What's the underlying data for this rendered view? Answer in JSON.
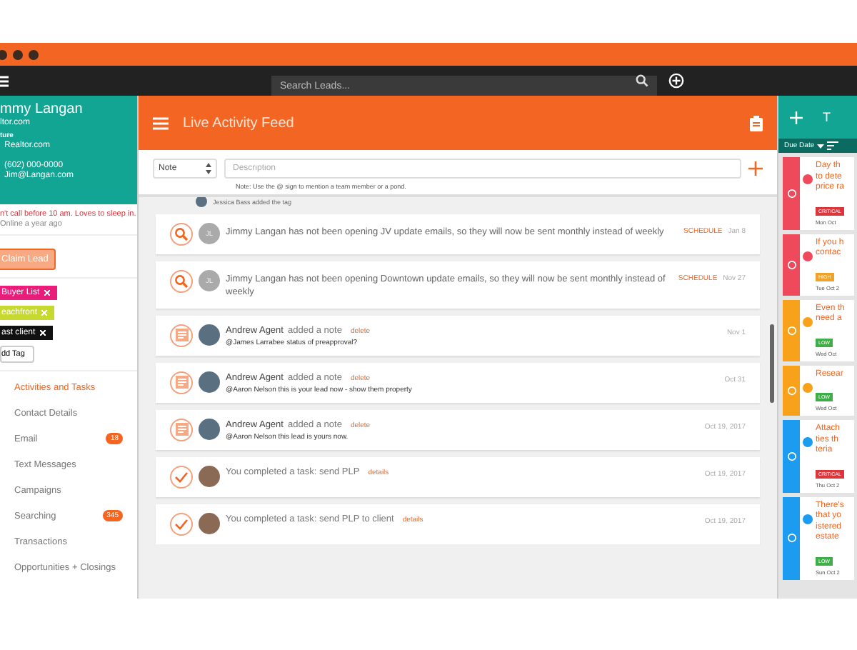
{
  "topbar": {
    "search": {
      "placeholder": "Search Leads..."
    }
  },
  "contact": {
    "name": "mmy Langan",
    "email_short": "ltor.com",
    "label": "ture",
    "source": "Realtor.com",
    "phone": "(602) 000-0000",
    "email": "Jim@Langan.com",
    "note": "n't call before 10 am. Loves to sleep in.",
    "last_seen": "Online a year ago",
    "claim_button": "Claim Lead",
    "tags": [
      {
        "label": "Buyer List",
        "color": "#e91e7a"
      },
      {
        "label": "eachfront",
        "color": "#c6d92e"
      },
      {
        "label": "ast client",
        "color": "#111111"
      }
    ],
    "add_tag": "dd Tag"
  },
  "nav": [
    {
      "label": "Activities and Tasks",
      "selected": true
    },
    {
      "label": "Contact Details",
      "selected": false
    },
    {
      "label": "Email",
      "selected": false,
      "badge": "18"
    },
    {
      "label": "Text Messages",
      "selected": false
    },
    {
      "label": "Campaigns",
      "selected": false
    },
    {
      "label": "Searching",
      "selected": false,
      "badge": "345"
    },
    {
      "label": "Transactions",
      "selected": false
    },
    {
      "label": "Opportunities + Closings",
      "selected": false
    }
  ],
  "feed": {
    "title": "Live Activity Feed",
    "type_select": "Note",
    "description": {
      "placeholder": "Description"
    },
    "hint": "Note: Use the @ sign to mention a team member or a pond.",
    "partial_row": "Jessica Bass added the tag",
    "items": [
      {
        "kind": "search",
        "initials": "JL",
        "text": "Jimmy Langan has not been opening JV update emails, so they will now be sent monthly instead of weekly",
        "action": "SCHEDULE",
        "date": "Jan 8"
      },
      {
        "kind": "search",
        "initials": "JL",
        "text": "Jimmy Langan has not been opening Downtown update emails, so they will now be sent monthly instead of weekly",
        "action": "SCHEDULE",
        "date": "Nov 27"
      },
      {
        "kind": "note",
        "author": "Andrew Agent",
        "verb": "added a note",
        "action": "delete",
        "body": "@James Larrabee status of preapproval?",
        "date": "Nov 1"
      },
      {
        "kind": "note",
        "author": "Andrew Agent",
        "verb": "added a note",
        "action": "delete",
        "body": "@Aaron Nelson this is your lead now - show them property",
        "date": "Oct 31"
      },
      {
        "kind": "note",
        "author": "Andrew Agent",
        "verb": "added a note",
        "action": "delete",
        "body": "@Aaron Nelson this lead is yours now.",
        "date": "Oct 19, 2017"
      },
      {
        "kind": "task",
        "text": "You completed a task: send PLP",
        "action": "details",
        "date": "Oct 19, 2017"
      },
      {
        "kind": "task",
        "text": "You completed a task: send PLP to client",
        "action": "details",
        "date": "Oct 19, 2017"
      }
    ]
  },
  "tasks": {
    "header": "T",
    "sort": "Due Date",
    "items": [
      {
        "color": "#ef4a5b",
        "lines": [
          "Day th",
          "to dete",
          "price ra"
        ],
        "badge": "CRITICAL",
        "date": "Mon Oct"
      },
      {
        "color": "#ef4a5b",
        "lines": [
          "If you h",
          "contac"
        ],
        "badge": "HIGH",
        "date": "Tue Oct 2"
      },
      {
        "color": "#f8a21c",
        "lines": [
          "Even th",
          "need a"
        ],
        "badge": "LOW",
        "date": "Wed Oct"
      },
      {
        "color": "#f8a21c",
        "lines": [
          "Resear"
        ],
        "badge": "LOW",
        "date": "Wed Oct"
      },
      {
        "color": "#1b9cf0",
        "lines": [
          "Attach",
          "ties th",
          "teria"
        ],
        "badge": "CRITICAL",
        "date": "Thu Oct 2"
      },
      {
        "color": "#1b9cf0",
        "lines": [
          "There's",
          "that yo",
          "istered",
          "estate"
        ],
        "badge": "LOW",
        "date": "Sun Oct 2"
      }
    ]
  }
}
